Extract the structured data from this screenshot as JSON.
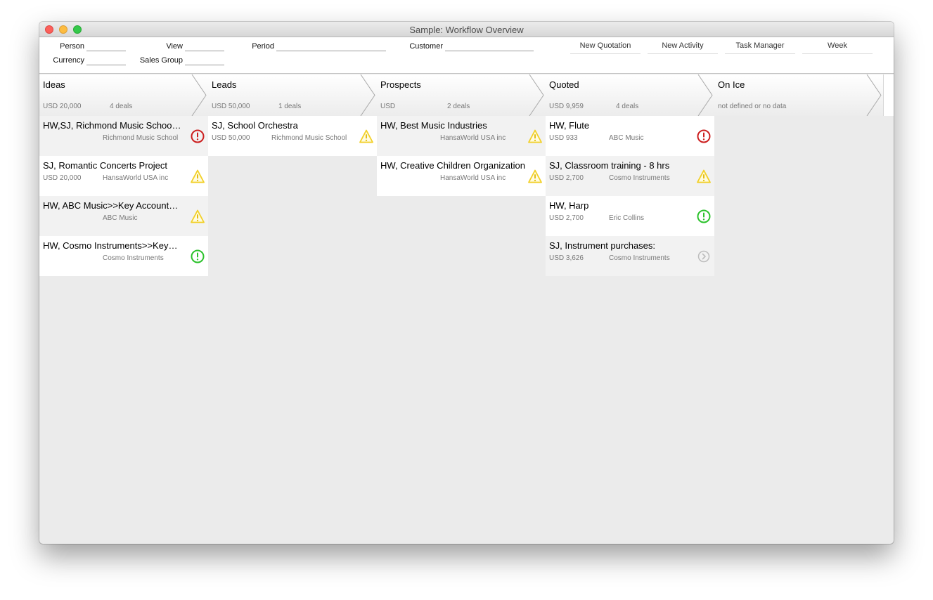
{
  "window": {
    "title": "Sample: Workflow Overview"
  },
  "filters": {
    "person": {
      "label": "Person",
      "value": ""
    },
    "view": {
      "label": "View",
      "value": ""
    },
    "period": {
      "label": "Period",
      "value": ""
    },
    "customer": {
      "label": "Customer",
      "value": ""
    },
    "currency": {
      "label": "Currency",
      "value": ""
    },
    "sales_group": {
      "label": "Sales Group",
      "value": ""
    }
  },
  "toolbar": {
    "new_quotation": "New Quotation",
    "new_activity": "New Activity",
    "task_manager": "Task Manager",
    "week": "Week"
  },
  "colors": {
    "status_red": "#cc1f1f",
    "status_yellow": "#f2d027",
    "status_green": "#2cc22c",
    "status_grey": "#bdbdbd"
  },
  "stages": [
    {
      "name": "Ideas",
      "amount": "USD 20,000",
      "count": "4 deals",
      "cards": [
        {
          "title": "HW,SJ, Richmond Music Schoo…",
          "amount": "",
          "company": "Richmond Music School",
          "status_icon": "alert-circle-icon-red"
        },
        {
          "title": "SJ, Romantic Concerts Project",
          "amount": "USD 20,000",
          "company": "HansaWorld USA inc",
          "status_icon": "warning-triangle-icon"
        },
        {
          "title": "HW, ABC Music>>Key Account…",
          "amount": "",
          "company": "ABC Music",
          "status_icon": "warning-triangle-icon"
        },
        {
          "title": "HW, Cosmo Instruments>>Key…",
          "amount": "",
          "company": "Cosmo Instruments",
          "status_icon": "alert-circle-icon-green"
        }
      ]
    },
    {
      "name": "Leads",
      "amount": "USD 50,000",
      "count": "1 deals",
      "cards": [
        {
          "title": "SJ, School Orchestra",
          "amount": "USD 50,000",
          "company": "Richmond Music School",
          "status_icon": "warning-triangle-icon"
        }
      ]
    },
    {
      "name": "Prospects",
      "amount": "USD",
      "count": "2 deals",
      "cards": [
        {
          "title": "HW, Best Music Industries",
          "amount": "",
          "company": "HansaWorld USA inc",
          "status_icon": "warning-triangle-icon"
        },
        {
          "title": "HW, Creative Children Organization",
          "amount": "",
          "company": "HansaWorld USA inc",
          "status_icon": "warning-triangle-icon"
        }
      ]
    },
    {
      "name": "Quoted",
      "amount": "USD 9,959",
      "count": "4 deals",
      "cards": [
        {
          "title": "HW, Flute",
          "amount": "USD 933",
          "company": "ABC Music",
          "status_icon": "alert-circle-icon-red"
        },
        {
          "title": "SJ, Classroom training - 8 hrs",
          "amount": "USD 2,700",
          "company": "Cosmo Instruments",
          "status_icon": "warning-triangle-icon"
        },
        {
          "title": "HW, Harp",
          "amount": "USD 2,700",
          "company": "Eric Collins",
          "status_icon": "alert-circle-icon-green"
        },
        {
          "title": "SJ, Instrument purchases:",
          "amount": "USD 3,626",
          "company": "Cosmo Instruments",
          "status_icon": "chevron-right-circle-icon"
        }
      ]
    },
    {
      "name": "On Ice",
      "note": "not defined or no data",
      "cards": []
    }
  ]
}
